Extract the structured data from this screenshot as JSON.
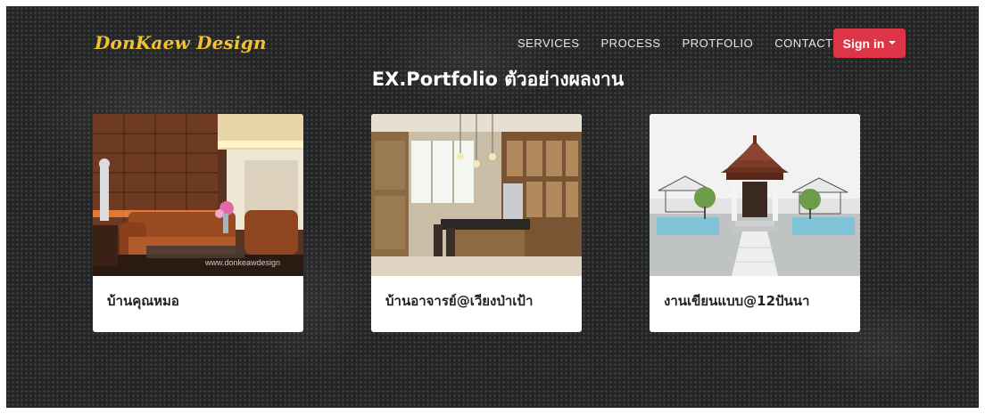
{
  "brand": {
    "name": "DonKaew Design"
  },
  "nav": {
    "items": [
      {
        "label": "SERVICES"
      },
      {
        "label": "PROCESS"
      },
      {
        "label": "PROTFOLIO"
      },
      {
        "label": "CONTACT"
      }
    ],
    "signin_label": "Sign in"
  },
  "portfolio": {
    "heading": "EX.Portfolio ตัวอย่างผลงาน",
    "cards": [
      {
        "title": "บ้านคุณหมอ",
        "image_subject": "living-room-interior",
        "watermark": "www.donkeawdesign"
      },
      {
        "title": "บ้านอาจารย์@เวียงป่าเป้า",
        "image_subject": "kitchen-interior"
      },
      {
        "title": "งานเขียนแบบ@12ปันนา",
        "image_subject": "thai-pavilion-render"
      }
    ]
  },
  "colors": {
    "background": "#242527",
    "brand": "#f2c12e",
    "signin": "#dc3545",
    "card": "#ffffff"
  }
}
